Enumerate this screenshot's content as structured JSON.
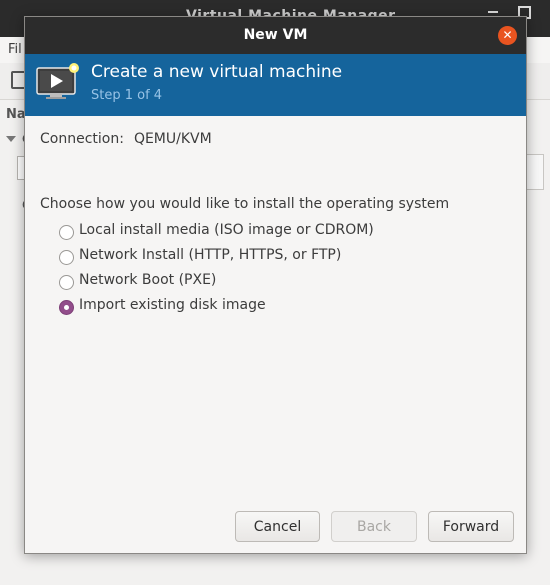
{
  "background_window": {
    "title": "Virtual Machine Manager",
    "menu_file": "Fil",
    "name_label": "Na",
    "letter1": "C",
    "letter2": "C"
  },
  "dialog": {
    "title": "New VM",
    "close_icon": "close-icon",
    "banner": {
      "title": "Create a new virtual machine",
      "step": "Step 1 of 4",
      "icon": "vm-monitor-icon"
    },
    "connection_label": "Connection:",
    "connection_value": "QEMU/KVM",
    "choose_label": "Choose how you would like to install the operating system",
    "options": [
      {
        "label": "Local install media (ISO image or CDROM)",
        "checked": false
      },
      {
        "label": "Network Install (HTTP, HTTPS, or FTP)",
        "checked": false
      },
      {
        "label": "Network Boot (PXE)",
        "checked": false
      },
      {
        "label": "Import existing disk image",
        "checked": true
      }
    ],
    "buttons": {
      "cancel": "Cancel",
      "back": "Back",
      "forward": "Forward"
    }
  },
  "colors": {
    "banner_bg": "#15649c",
    "accent_close": "#e95420",
    "radio_checked": "#924d8b"
  }
}
